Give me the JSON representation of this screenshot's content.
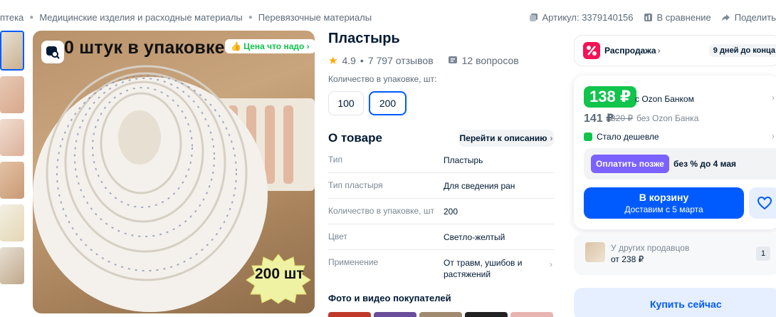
{
  "breadcrumb": {
    "items": [
      "птека",
      "Медицинские изделия и расходные материалы",
      "Перевязочные материалы"
    ]
  },
  "topmeta": {
    "article": "Артикул: 3379140156",
    "compare": "В сравнение",
    "share": "Поделить"
  },
  "image": {
    "overlay_title": "0 штук в упаковке",
    "badge": "Цена что надо",
    "star_text": "200 шт"
  },
  "product": {
    "title": "Пластырь",
    "rating": "4.9",
    "reviews": "7 797 отзывов",
    "questions": "12 вопросов",
    "qty_label": "Количество в упаковке, шт:",
    "qty_options": [
      "100",
      "200"
    ],
    "qty_selected": "200"
  },
  "about": {
    "heading": "О товаре",
    "goto_desc": "Перейти к описанию",
    "specs": [
      {
        "k": "Тип",
        "v": "Пластырь"
      },
      {
        "k": "Тип пластыря",
        "v": "Для сведения ран"
      },
      {
        "k": "Количество в упаковке, шт",
        "v": "200"
      },
      {
        "k": "Цвет",
        "v": "Светло-желтый"
      },
      {
        "k": "Применение",
        "v": "От травм, ушибов и растяжений"
      }
    ],
    "photos_heading": "Фото и видео покупателей"
  },
  "sale": {
    "label": "Распродажа",
    "days": "9 дней до конца"
  },
  "price": {
    "ozon_price": "138 ₽",
    "ozon_bank": "с Ozon Банком",
    "normal_price": "141 ₽",
    "old_price": "320 ₽",
    "no_bank": "без Ozon Банка",
    "cheaper": "Стало дешевле",
    "pay_later_btn": "Оплатить позже",
    "pay_later_text": "без % до 4 мая",
    "cart_label": "В корзину",
    "cart_delivery": "Доставим с 5 марта"
  },
  "others": {
    "title": "У других продавцов",
    "price": "от 238 ₽",
    "count": "1"
  },
  "buy_now": "Купить сейчас",
  "colors": {
    "accent": "#005bff",
    "green": "#10c44c",
    "purple": "#7b61ff"
  }
}
